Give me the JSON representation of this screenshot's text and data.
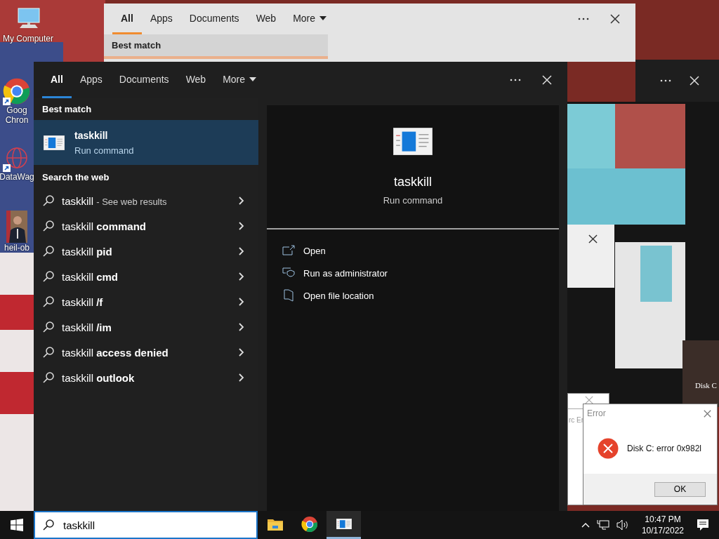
{
  "desktop_icons": [
    {
      "kind": "computer",
      "lines": [
        "My Computer"
      ],
      "shortcut": false
    },
    {
      "kind": "chrome",
      "lines": [
        "Goog",
        "Chron"
      ],
      "shortcut": true
    },
    {
      "kind": "web",
      "lines": [
        "DataWag"
      ],
      "shortcut": true
    },
    {
      "lines": [
        "heil-ob"
      ],
      "shortcut": false
    }
  ],
  "background_search": {
    "tabs": [
      {
        "label": "All",
        "selected": true
      },
      {
        "label": "Apps",
        "selected": false
      },
      {
        "label": "Documents",
        "selected": false
      },
      {
        "label": "Web",
        "selected": false
      },
      {
        "label": "More",
        "selected": false
      }
    ],
    "section": "Best match"
  },
  "search_panel": {
    "tabs": [
      {
        "label": "All",
        "selected": true
      },
      {
        "label": "Apps",
        "selected": false
      },
      {
        "label": "Documents",
        "selected": false
      },
      {
        "label": "Web",
        "selected": false
      },
      {
        "label": "More",
        "selected": false
      }
    ],
    "best_match_header": "Best match",
    "best_match": {
      "title": "taskkill",
      "subtitle": "Run command",
      "selected": true
    },
    "web_header": "Search the web",
    "web_results": [
      {
        "text": "taskkill",
        "note": "- See web results"
      },
      {
        "text": "taskkill **command**"
      },
      {
        "text": "taskkill **pid**"
      },
      {
        "text": "taskkill **cmd**"
      },
      {
        "text": "taskkill **/f**"
      },
      {
        "text": "taskkill **/im**"
      },
      {
        "text": "taskkill **access denied**"
      },
      {
        "text": "taskkill **outlook**"
      }
    ],
    "preview": {
      "title": "taskkill",
      "subtitle": "Run command",
      "actions": [
        {
          "kind": "open",
          "label": "Open"
        },
        {
          "kind": "admin",
          "label": "Run as administrator"
        },
        {
          "kind": "folder",
          "label": "Open file location"
        }
      ]
    }
  },
  "glitch_text": "Disk C",
  "ghost_dialog_title": "rc Er",
  "error_dialog": {
    "title": "Error",
    "message": "Disk C: error 0x982l",
    "button": "OK"
  },
  "taskbar": {
    "search_value": "taskkill",
    "apps": [
      {
        "kind": "explorer",
        "active": false
      },
      {
        "kind": "chrome",
        "active": false
      },
      {
        "kind": "app",
        "active": true
      }
    ],
    "time": "10:47 PM",
    "date": "10/17/2022"
  }
}
